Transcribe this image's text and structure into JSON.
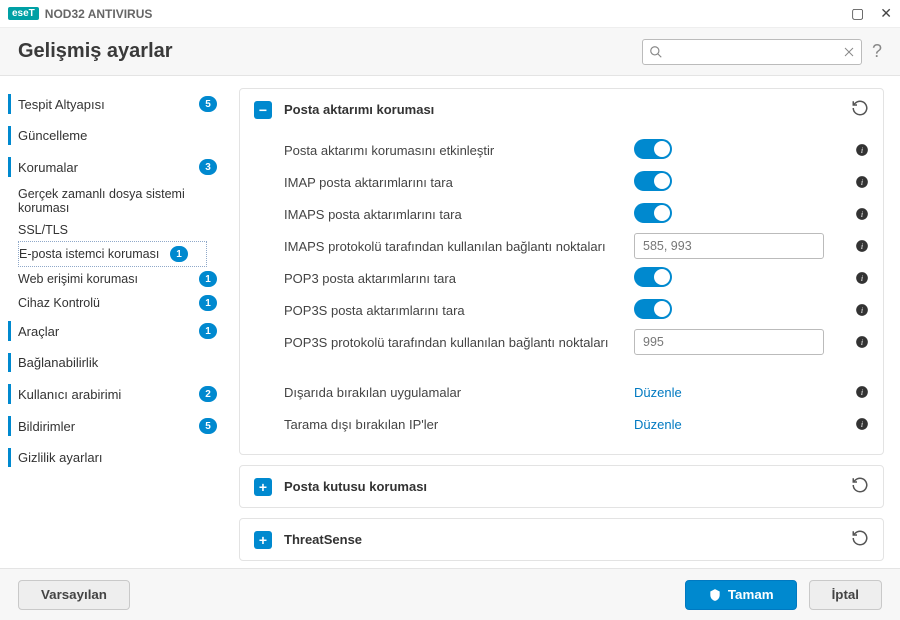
{
  "app": {
    "brand_chip": "eseT",
    "brand_name": "NOD32 ANTIVIRUS"
  },
  "header": {
    "title": "Gelişmiş ayarlar",
    "search_placeholder": ""
  },
  "sidebar": {
    "items": [
      {
        "label": "Tespit Altyapısı",
        "badge": "5"
      },
      {
        "label": "Güncelleme",
        "badge": ""
      },
      {
        "label": "Korumalar",
        "badge": "3",
        "children": [
          {
            "label": "Gerçek zamanlı dosya sistemi koruması",
            "badge": ""
          },
          {
            "label": "SSL/TLS",
            "badge": ""
          },
          {
            "label": "E-posta istemci koruması",
            "badge": "1",
            "selected": true
          },
          {
            "label": "Web erişimi koruması",
            "badge": "1"
          },
          {
            "label": "Cihaz Kontrolü",
            "badge": "1"
          }
        ]
      },
      {
        "label": "Araçlar",
        "badge": "1"
      },
      {
        "label": "Bağlanabilirlik",
        "badge": ""
      },
      {
        "label": "Kullanıcı arabirimi",
        "badge": "2"
      },
      {
        "label": "Bildirimler",
        "badge": "5"
      },
      {
        "label": "Gizlilik ayarları",
        "badge": ""
      }
    ]
  },
  "panels": {
    "p1": {
      "title": "Posta aktarımı koruması",
      "rows": [
        {
          "label": "Posta aktarımı korumasını etkinleştir",
          "type": "toggle",
          "value": true
        },
        {
          "label": "IMAP posta aktarımlarını tara",
          "type": "toggle",
          "value": true
        },
        {
          "label": "IMAPS posta aktarımlarını tara",
          "type": "toggle",
          "value": true
        },
        {
          "label": "IMAPS protokolü tarafından kullanılan bağlantı noktaları",
          "type": "text",
          "value": "585, 993"
        },
        {
          "label": "POP3 posta aktarımlarını tara",
          "type": "toggle",
          "value": true
        },
        {
          "label": "POP3S posta aktarımlarını tara",
          "type": "toggle",
          "value": true
        },
        {
          "label": "POP3S protokolü tarafından kullanılan bağlantı noktaları",
          "type": "text",
          "value": "995"
        }
      ],
      "extra": [
        {
          "label": "Dışarıda bırakılan uygulamalar",
          "action": "Düzenle"
        },
        {
          "label": "Tarama dışı bırakılan IP'ler",
          "action": "Düzenle"
        }
      ]
    },
    "p2": {
      "title": "Posta kutusu koruması"
    },
    "p3": {
      "title": "ThreatSense"
    }
  },
  "footer": {
    "default": "Varsayılan",
    "ok": "Tamam",
    "cancel": "İptal"
  }
}
